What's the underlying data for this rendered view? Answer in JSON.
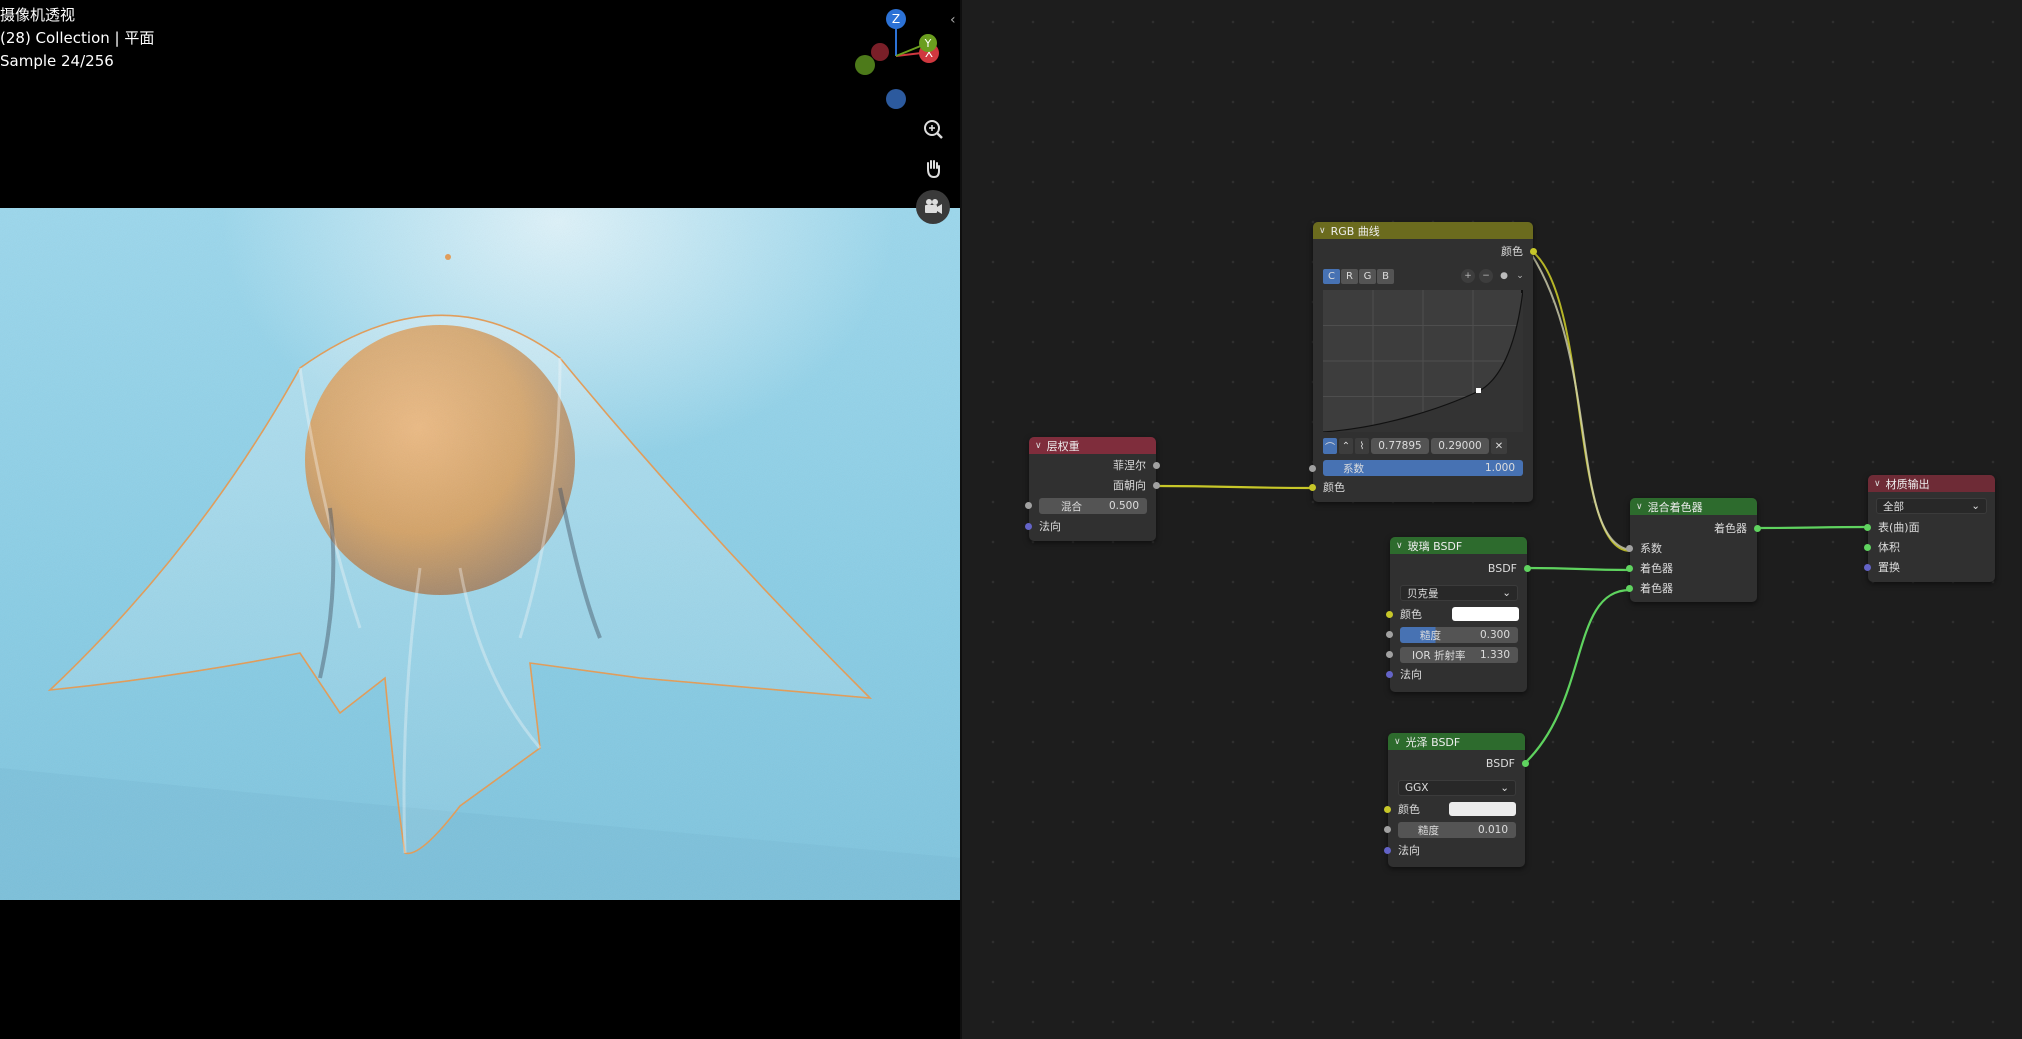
{
  "viewport": {
    "title": "摄像机透视",
    "collection": "(28) Collection | 平面",
    "sample": "Sample 24/256",
    "gizmo": {
      "z": "Z",
      "y": "Y",
      "x": "X"
    },
    "icons": [
      "zoom-icon",
      "hand-icon",
      "camera-icon"
    ]
  },
  "nodes": {
    "layer_weight": {
      "title": "层权重",
      "out_fresnel": "菲涅尔",
      "out_facing": "面朝向",
      "blend_label": "混合",
      "blend_value": "0.500",
      "normal": "法向"
    },
    "rgb_curves": {
      "title": "RGB 曲线",
      "out_color": "颜色",
      "channels": [
        "C",
        "R",
        "G",
        "B"
      ],
      "point_x": "0.77895",
      "point_y": "0.29000",
      "factor_label": "系数",
      "factor_value": "1.000",
      "in_color": "颜色"
    },
    "glass_bsdf": {
      "title": "玻璃 BSDF",
      "out": "BSDF",
      "distribution": "贝克曼",
      "color_label": "颜色",
      "roughness_label": "糙度",
      "roughness_value": "0.300",
      "ior_label": "IOR 折射率",
      "ior_value": "1.330",
      "normal": "法向"
    },
    "glossy_bsdf": {
      "title": "光泽 BSDF",
      "out": "BSDF",
      "distribution": "GGX",
      "color_label": "颜色",
      "roughness_label": "糙度",
      "roughness_value": "0.010",
      "normal": "法向"
    },
    "mix_shader": {
      "title": "混合着色器",
      "out": "着色器",
      "in_fac": "系数",
      "in_shader1": "着色器",
      "in_shader2": "着色器"
    },
    "material_output": {
      "title": "材质输出",
      "target": "全部",
      "surface": "表(曲)面",
      "volume": "体积",
      "displacement": "置换"
    }
  },
  "colors": {
    "socket_gray": "#a1a1a1",
    "socket_yellow": "#c7c729",
    "socket_green": "#5fd35f",
    "socket_purple": "#6363c7",
    "accent_blue": "#4772b3"
  }
}
